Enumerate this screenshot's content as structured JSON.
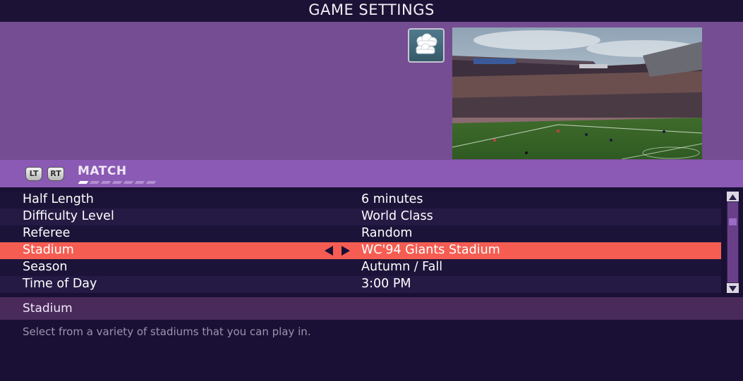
{
  "header": {
    "title": "GAME SETTINGS"
  },
  "banner": {
    "weather_icon": "cloudy-icon",
    "preview_description_icon": "stadium-preview"
  },
  "tabs": {
    "left_trigger": "LT",
    "right_trigger": "RT",
    "current": "MATCH",
    "page_count": 7,
    "current_page": 1
  },
  "settings": [
    {
      "label": "Half Length",
      "value": "6 minutes"
    },
    {
      "label": "Difficulty Level",
      "value": "World Class"
    },
    {
      "label": "Referee",
      "value": "Random"
    },
    {
      "label": "Stadium",
      "value": "WC'94 Giants Stadium",
      "selected": true
    },
    {
      "label": "Season",
      "value": "Autumn / Fall"
    },
    {
      "label": "Time of Day",
      "value": "3:00 PM"
    }
  ],
  "description": {
    "title": "Stadium",
    "text": "Select from a variety of stadiums that you can play in."
  },
  "colors": {
    "selected_row": "#f55d52",
    "banner": "#754d92",
    "tab_bar": "#8b5ab5"
  }
}
